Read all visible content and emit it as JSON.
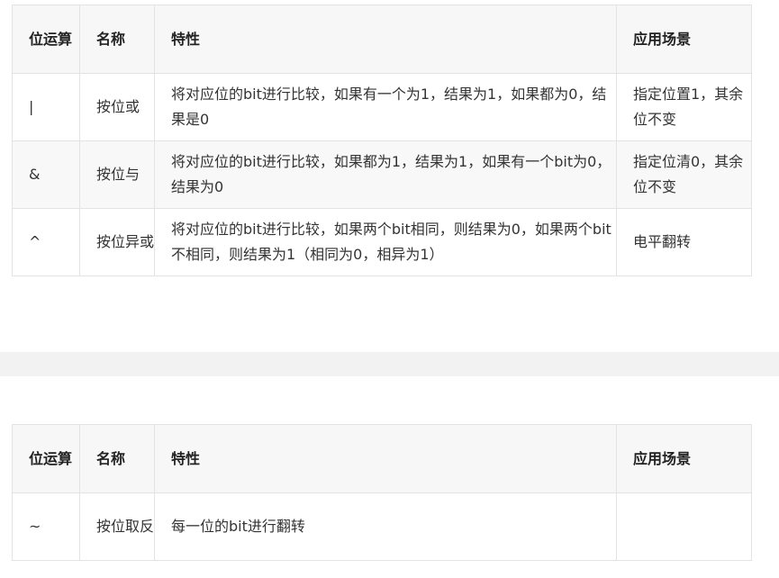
{
  "table1": {
    "headers": {
      "op": "位运算",
      "name": "名称",
      "feature": "特性",
      "application": "应用场景"
    },
    "rows": [
      {
        "op": "|",
        "name": "按位或",
        "feature": "将对应位的bit进行比较，如果有一个为1，结果为1，如果都为0，结果是0",
        "application": "指定位置1，其余位不变"
      },
      {
        "op": "&",
        "name": "按位与",
        "feature": "将对应位的bit进行比较，如果都为1，结果为1，如果有一个bit为0，结果为0",
        "application": "指定位清0，其余位不变"
      },
      {
        "op": "^",
        "name": "按位异或",
        "feature": "将对应位的bit进行比较，如果两个bit相同，则结果为0，如果两个bit不相同，则结果为1（相同为0，相异为1）",
        "application": "电平翻转"
      }
    ]
  },
  "table2": {
    "headers": {
      "op": "位运算",
      "name": "名称",
      "feature": "特性",
      "application": "应用场景"
    },
    "rows": [
      {
        "op": "~",
        "name": "按位取反",
        "feature": "每一位的bit进行翻转",
        "application": ""
      }
    ]
  }
}
